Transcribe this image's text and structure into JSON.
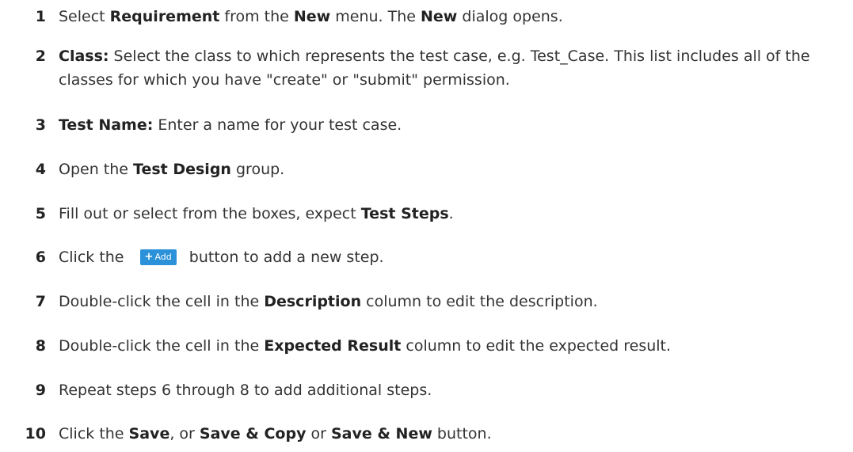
{
  "steps": [
    {
      "num": "1",
      "parts": [
        [
          "Select ",
          false
        ],
        [
          "Requirement",
          true
        ],
        [
          " from the ",
          false
        ],
        [
          "New",
          true
        ],
        [
          " menu. The ",
          false
        ],
        [
          "New",
          true
        ],
        [
          " dialog opens.",
          false
        ]
      ]
    },
    {
      "num": "2",
      "parts": [
        [
          "Class:",
          true
        ],
        [
          " Select the class to which represents the test case, e.g. Test_Case. This list includes all of the classes for which you have \"create\" or \"submit\" permission.",
          false
        ]
      ]
    },
    {
      "num": "3",
      "parts": [
        [
          "Test Name:",
          true
        ],
        [
          " Enter a name for your test case.",
          false
        ]
      ]
    },
    {
      "num": "4",
      "parts": [
        [
          "Open the ",
          false
        ],
        [
          "Test Design",
          true
        ],
        [
          " group.",
          false
        ]
      ]
    },
    {
      "num": "5",
      "parts": [
        [
          "Fill out or select from the boxes, expect ",
          false
        ],
        [
          "Test Steps",
          true
        ],
        [
          ".",
          false
        ]
      ]
    },
    {
      "num": "6",
      "pre": "Click the",
      "button": {
        "icon": "plus-icon",
        "glyph": "+",
        "label": "Add"
      },
      "post": "button to add a new step."
    },
    {
      "num": "7",
      "parts": [
        [
          "Double-click the cell in the ",
          false
        ],
        [
          "Description",
          true
        ],
        [
          " column to edit the description.",
          false
        ]
      ]
    },
    {
      "num": "8",
      "parts": [
        [
          "Double-click the cell in the ",
          false
        ],
        [
          "Expected Result",
          true
        ],
        [
          " column to edit the expected result.",
          false
        ]
      ]
    },
    {
      "num": "9",
      "parts": [
        [
          "Repeat steps 6 through 8 to add additional steps.",
          false
        ]
      ]
    },
    {
      "num": "10",
      "parts": [
        [
          "Click the ",
          false
        ],
        [
          "Save",
          true
        ],
        [
          ", or ",
          false
        ],
        [
          "Save & Copy",
          true
        ],
        [
          " or ",
          false
        ],
        [
          "Save & New",
          true
        ],
        [
          " button.",
          false
        ]
      ]
    }
  ],
  "colors": {
    "text": "#333333",
    "button_bg": "#2b91d9",
    "button_text": "#ffffff"
  }
}
